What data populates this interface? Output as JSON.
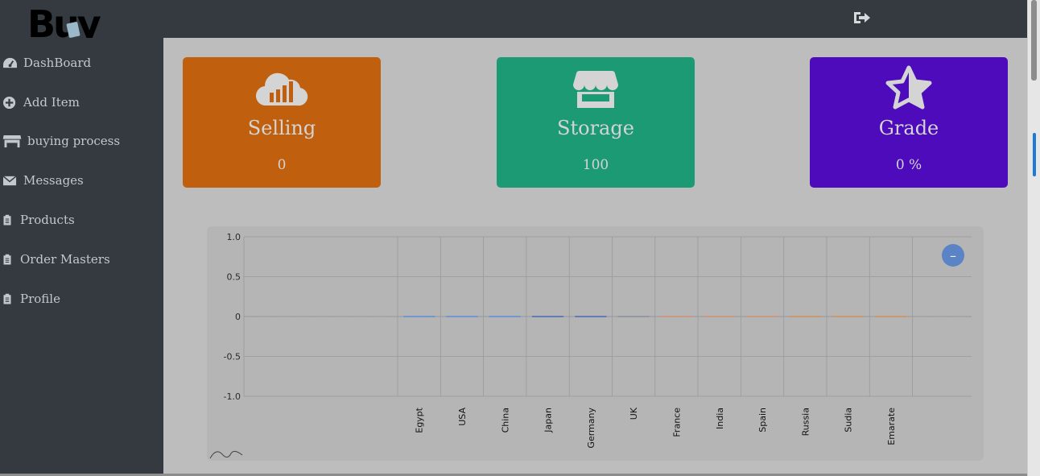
{
  "app": {
    "logo_text": "Buy"
  },
  "header": {
    "logout_icon": "sign-out-icon"
  },
  "sidebar": {
    "items": [
      {
        "label": "DashBoard",
        "icon": "tachometer-icon"
      },
      {
        "label": "Add Item",
        "icon": "plus-circle-icon"
      },
      {
        "label": "buying process",
        "icon": "store-icon"
      },
      {
        "label": "Messages",
        "icon": "envelope-icon"
      },
      {
        "label": "Products",
        "icon": "clipboard-icon"
      },
      {
        "label": "Order Masters",
        "icon": "clipboard-icon"
      },
      {
        "label": "Profile",
        "icon": "clipboard-icon"
      }
    ]
  },
  "cards": [
    {
      "title": "Selling",
      "value": "0",
      "icon": "cloud-chart-icon",
      "color": "#c0600e"
    },
    {
      "title": "Storage",
      "value": "100",
      "icon": "store-icon",
      "color": "#1b9a74"
    },
    {
      "title": "Grade",
      "value": "0 %",
      "icon": "star-icon",
      "color": "#4d0bbb"
    }
  ],
  "chart_data": {
    "type": "line",
    "categories": [
      "Egypt",
      "USA",
      "China",
      "Japan",
      "Germany",
      "UK",
      "France",
      "India",
      "Spain",
      "Russia",
      "Sudia",
      "Emarate"
    ],
    "values": [
      0,
      0,
      0,
      0,
      0,
      0,
      0,
      0,
      0,
      0,
      0,
      0
    ],
    "y_ticks": [
      "1.0",
      "0.5",
      "0",
      "-0.5",
      "-1.0"
    ],
    "ylim": [
      -1,
      1
    ],
    "grid": true,
    "colors": [
      "#5b8fd6",
      "#5b8fd6",
      "#5b8fd6",
      "#4a6ab5",
      "#4a6ab5",
      "#8a8fa0",
      "#d09070",
      "#d09070",
      "#d09070",
      "#d0905a",
      "#d0905a",
      "#d0905a"
    ]
  },
  "chart_panel": {
    "toggle_label": "–"
  },
  "colors": {
    "sidebar_bg": "#343a40",
    "content_bg": "#bdbdbd"
  }
}
